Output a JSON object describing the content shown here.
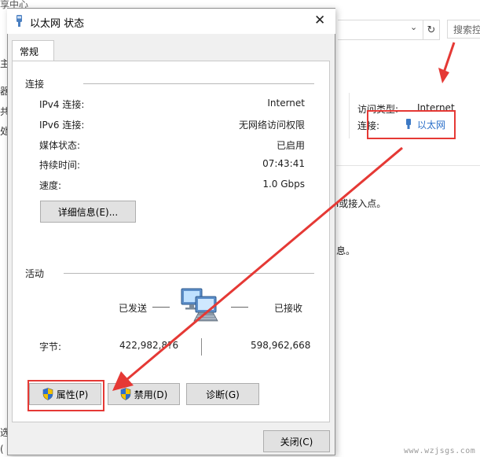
{
  "background_window": {
    "title_fragment": "享中心",
    "search_placeholder": "搜索控",
    "access_type_label": "访问类型:",
    "access_type_value": "Internet",
    "connection_label": "连接:",
    "connection_value": "以太网",
    "left_fragments": [
      "主",
      "器",
      "共",
      "处",
      "选",
      "("
    ],
    "text_fragment_1": "ו或接入点。",
    "text_fragment_2": "息。"
  },
  "dialog": {
    "title": "以太网 状态",
    "tab_label": "常规",
    "connection_section": {
      "heading": "连接",
      "rows": [
        {
          "label": "IPv4 连接:",
          "value": "Internet"
        },
        {
          "label": "IPv6 连接:",
          "value": "无网络访问权限"
        },
        {
          "label": "媒体状态:",
          "value": "已启用"
        },
        {
          "label": "持续时间:",
          "value": "07:43:41"
        },
        {
          "label": "速度:",
          "value": "1.0 Gbps"
        }
      ],
      "details_button": "详细信息(E)..."
    },
    "activity_section": {
      "heading": "活动",
      "sent_label": "已发送",
      "received_label": "已接收",
      "bytes_label": "字节:",
      "bytes_sent": "422,982,8?6",
      "bytes_received": "598,962,668"
    },
    "buttons": {
      "properties": "属性(P)",
      "disable": "禁用(D)",
      "diagnose": "诊断(G)",
      "close": "关闭(C)"
    }
  },
  "watermark": "www.wzjsgs.com",
  "colors": {
    "annotation_red": "#e53935",
    "link_blue": "#2a6fc9",
    "dialog_bg": "#f0f0f0"
  },
  "icons": {
    "title": "ethernet-icon",
    "shield": "uac-shield-icon",
    "network": "network-computers-icon",
    "close": "close-icon"
  }
}
